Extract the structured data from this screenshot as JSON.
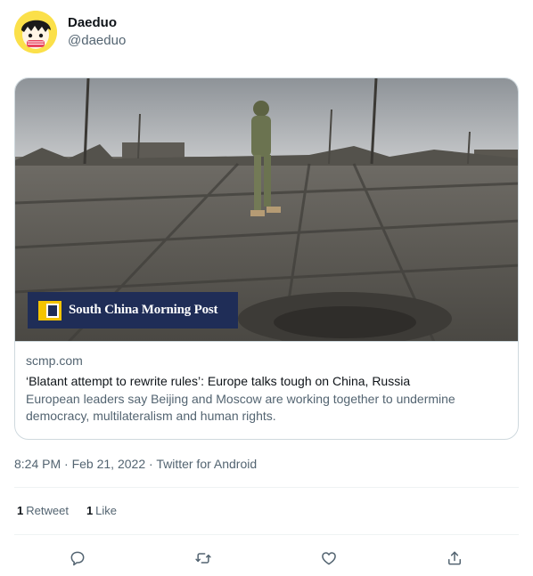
{
  "author": {
    "display_name": "Daeduo",
    "handle": "@daeduo",
    "avatar_icon": "cartoon-avatar-icon"
  },
  "card": {
    "brand_text": "South China Morning Post",
    "domain": "scmp.com",
    "title": "‘Blatant attempt to rewrite rules’: Europe talks tough on China, Russia",
    "description": "European leaders say Beijing and Moscow are working together to undermine democracy, multilateralism and human rights."
  },
  "meta": {
    "time": "8:24 PM",
    "separator1": " · ",
    "date": "Feb 21, 2022",
    "separator2": " · ",
    "source": "Twitter for Android"
  },
  "stats": {
    "retweets_count": "1",
    "retweets_label": "Retweet",
    "likes_count": "1",
    "likes_label": "Like"
  },
  "actions": {
    "reply_icon": "reply-icon",
    "retweet_icon": "retweet-icon",
    "like_icon": "heart-icon",
    "share_icon": "share-icon"
  },
  "colors": {
    "text": "#0f1419",
    "secondary": "#536471",
    "border": "#cfd9de",
    "scmp_navy": "#1f2d57",
    "scmp_yellow": "#f5c400"
  }
}
